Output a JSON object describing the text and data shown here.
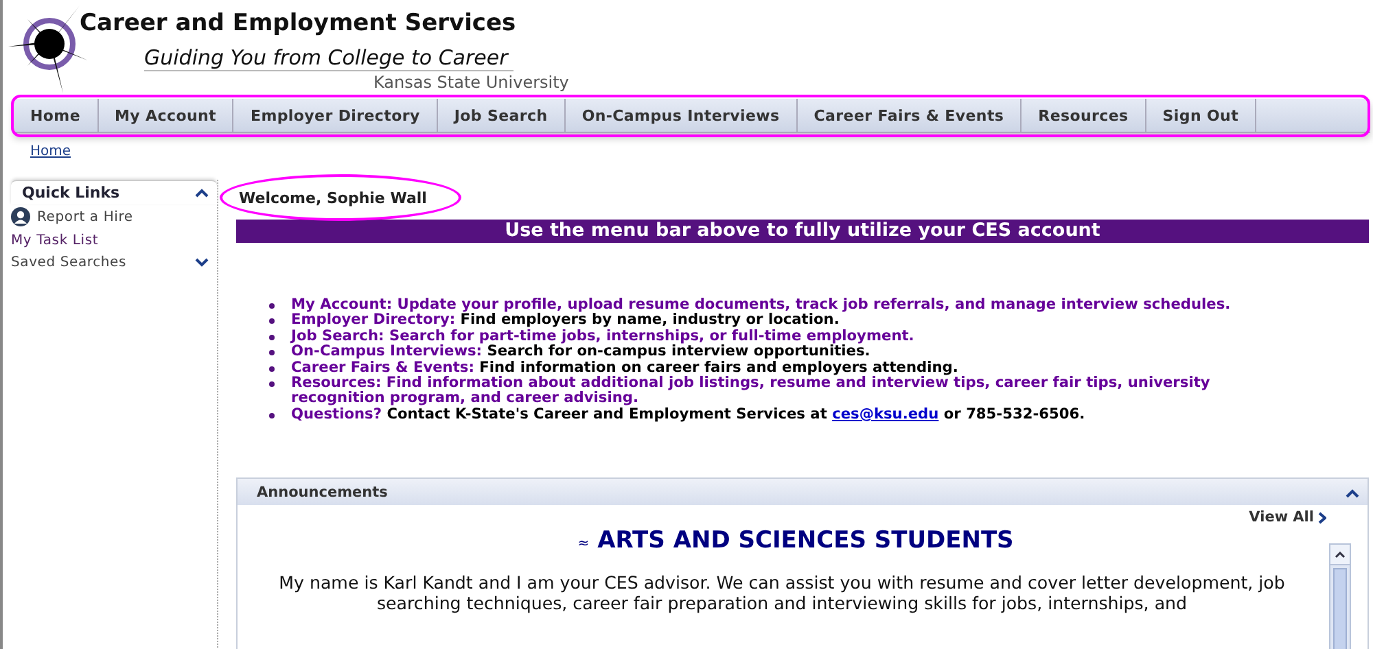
{
  "header": {
    "title": "Career and Employment Services",
    "tagline": "Guiding You from College to Career",
    "university": "Kansas State University"
  },
  "nav": {
    "highlighted": true,
    "items": [
      {
        "label": "Home"
      },
      {
        "label": "My Account"
      },
      {
        "label": "Employer Directory"
      },
      {
        "label": "Job Search"
      },
      {
        "label": "On-Campus Interviews"
      },
      {
        "label": "Career Fairs & Events"
      },
      {
        "label": "Resources"
      },
      {
        "label": "Sign Out"
      }
    ]
  },
  "breadcrumb": "Home",
  "sidebar": {
    "title": "Quick Links",
    "expanded": true,
    "items": [
      {
        "label": "Report a Hire",
        "kind": "icon-link"
      },
      {
        "label": "My Task List",
        "kind": "link"
      },
      {
        "label": "Saved Searches",
        "kind": "group",
        "expanded": false
      }
    ]
  },
  "welcome": {
    "text": "Welcome, Sophie Wall",
    "highlighted": true
  },
  "banner": "Use the menu bar above to fully utilize your CES account",
  "features": [
    {
      "label": "My Account:",
      "text": " Update your profile, upload resume documents, track job referrals, and manage interview schedules.",
      "kind": "highlighted"
    },
    {
      "label": "Employer Directory:",
      "text": "Find employers by name, industry or location.",
      "kind": "plain"
    },
    {
      "label": "Job Search:",
      "text": "Search for part-time jobs, internships, or full-time employment.",
      "kind": "highlighted"
    },
    {
      "label": "On-Campus Interviews:",
      "text": "Search for on-campus interview opportunities.",
      "kind": "plain"
    },
    {
      "label": "Career Fairs & Events:",
      "text": "Find information on career fairs and employers attending.",
      "kind": "plain"
    },
    {
      "label": "Resources:",
      "text": "Find information about additional job listings, resume and interview tips, career fair tips, university recognition program, and career advising.",
      "kind": "highlighted"
    },
    {
      "label": "Questions?",
      "text": "Contact K-State's Career and Employment Services at",
      "link": "ces@ksu.edu",
      "after": "or 785-532-6506.",
      "kind": "plain"
    }
  ],
  "announcements": {
    "title": "Announcements",
    "expanded": true,
    "view_all": "View All",
    "heading_icon": "≈",
    "heading": "ARTS AND SCIENCES STUDENTS",
    "body": "My name is Karl Kandt and I am your CES advisor. We can assist you with resume and cover letter development, job searching techniques, career fair preparation and interviewing skills for jobs, internships, and"
  }
}
